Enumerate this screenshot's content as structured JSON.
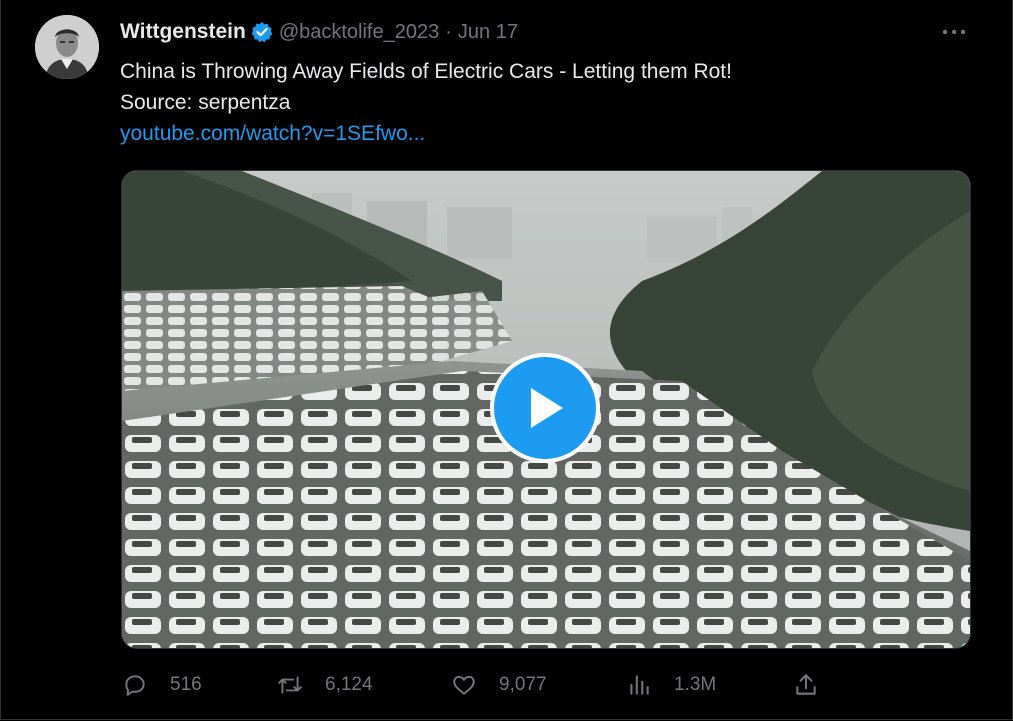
{
  "author": {
    "name": "Wittgenstein",
    "handle": "@backtolife_2023",
    "separator": "·",
    "date": "Jun 17"
  },
  "tweet": {
    "line1": "China is Throwing Away Fields of Electric Cars - Letting them Rot!",
    "line2": "Source: serpentza",
    "link": "youtube.com/watch?v=1SEfwo..."
  },
  "media": {
    "type": "video",
    "icon": "play-icon"
  },
  "actions": {
    "replies": "516",
    "retweets": "6,124",
    "likes": "9,077",
    "views": "1.3M"
  },
  "colors": {
    "accent": "#1d9bf0",
    "muted": "#71767b",
    "text": "#e7e9ea",
    "background": "#000000"
  }
}
